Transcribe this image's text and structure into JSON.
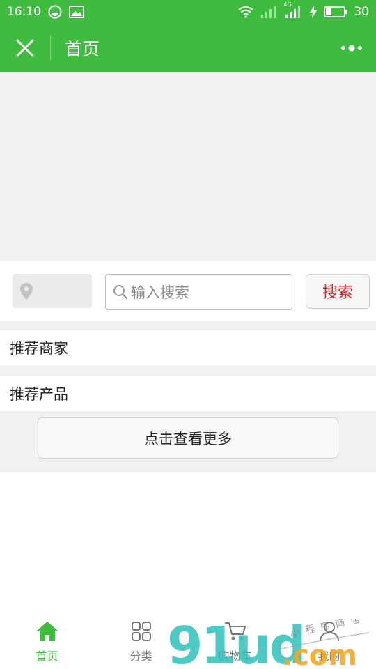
{
  "status_bar": {
    "time": "16:10",
    "battery_level": "30",
    "network_label": "4G"
  },
  "nav": {
    "title": "首页"
  },
  "search": {
    "placeholder": "输入搜索",
    "button_label": "搜索"
  },
  "sections": {
    "merchants_title": "推荐商家",
    "products_title": "推荐产品"
  },
  "more_button_label": "点击查看更多",
  "tabs": [
    {
      "label": "首页",
      "icon": "home-icon",
      "active": true
    },
    {
      "label": "分类",
      "icon": "category-icon",
      "active": false
    },
    {
      "label": "购物车",
      "icon": "cart-icon",
      "active": false
    },
    {
      "label": "我的",
      "icon": "user-icon",
      "active": false
    }
  ],
  "watermark": {
    "text": "91ud.com",
    "tagline": "小程序商店"
  },
  "colors": {
    "brand_green": "#3fbb3f",
    "search_red": "#c9262b",
    "background_gray": "#f2f1f0"
  }
}
